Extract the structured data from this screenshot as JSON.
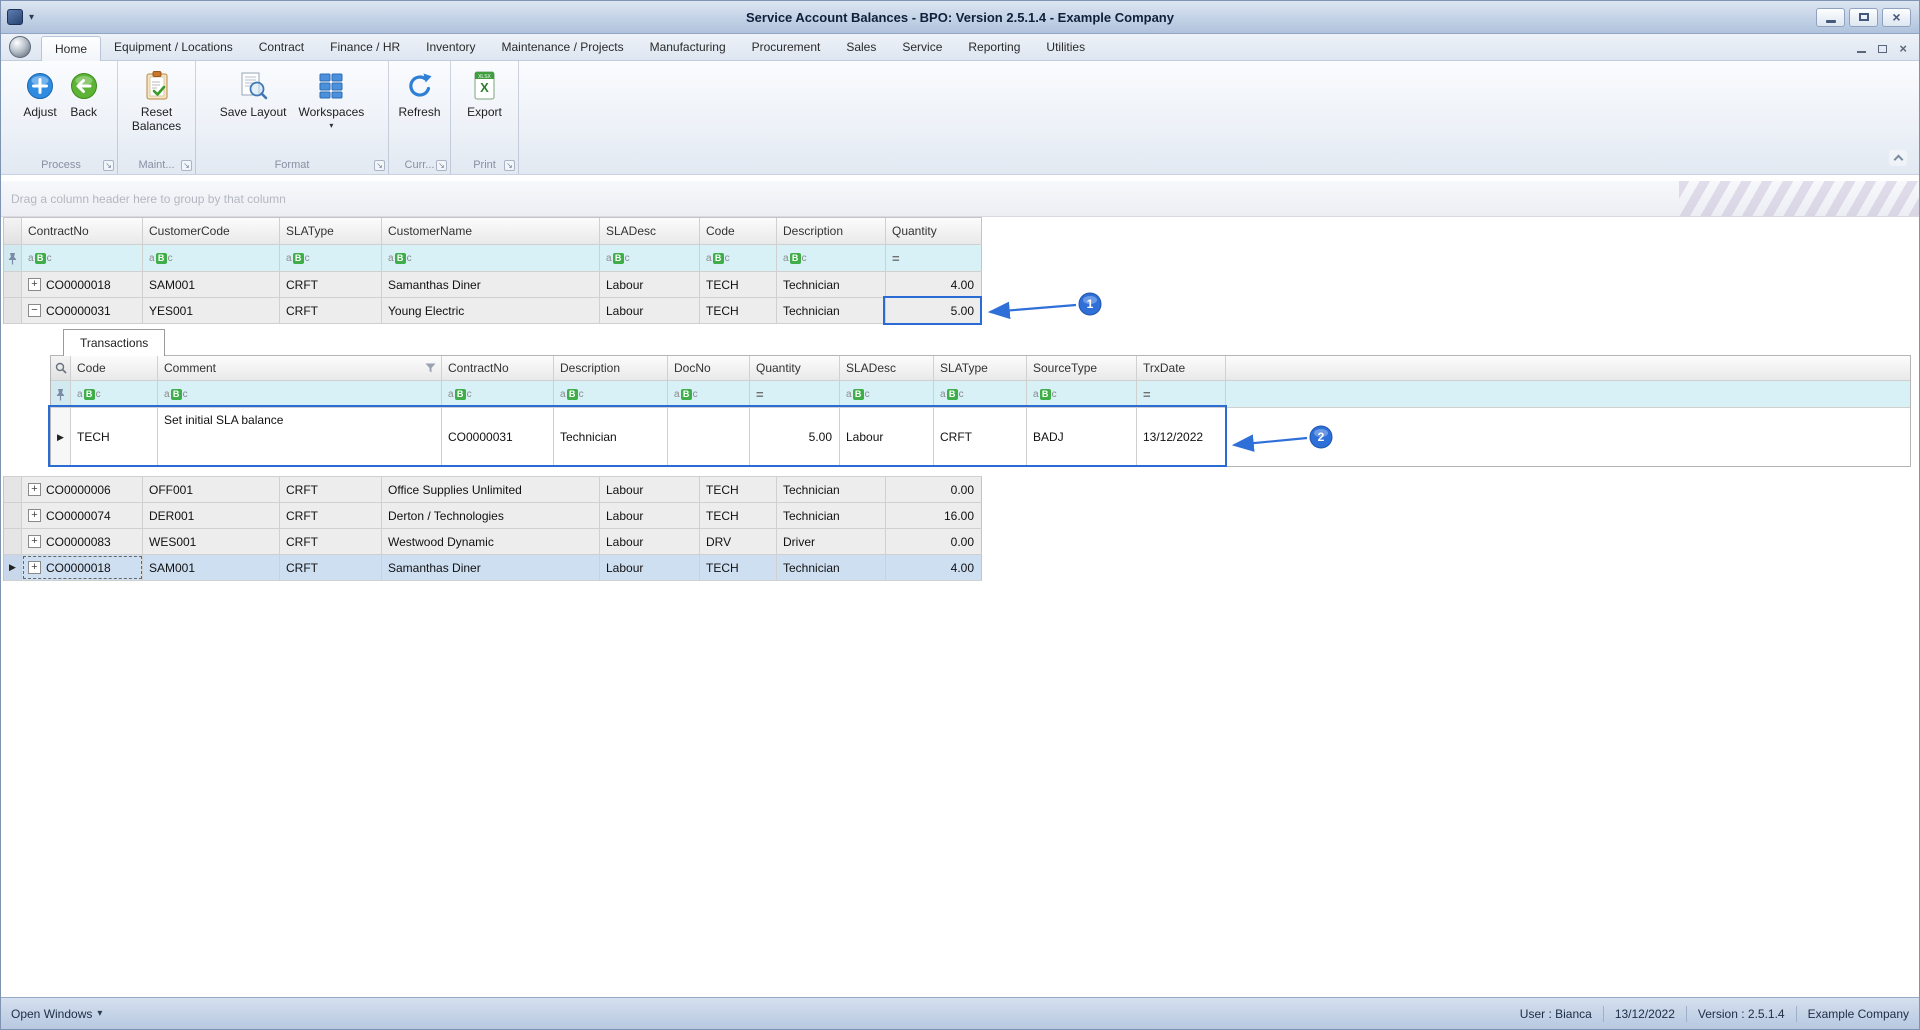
{
  "title_bar": {
    "title": "Service Account Balances - BPO: Version 2.5.1.4 - Example Company"
  },
  "ribbon": {
    "tabs": [
      "Home",
      "Equipment / Locations",
      "Contract",
      "Finance / HR",
      "Inventory",
      "Maintenance / Projects",
      "Manufacturing",
      "Procurement",
      "Sales",
      "Service",
      "Reporting",
      "Utilities"
    ],
    "buttons": {
      "adjust": "Adjust",
      "back": "Back",
      "reset_balances": "Reset Balances",
      "save_layout": "Save Layout",
      "workspaces": "Workspaces",
      "refresh": "Refresh",
      "export": "Export"
    },
    "groups": {
      "process": "Process",
      "maint": "Maint...",
      "format": "Format",
      "curr": "Curr...",
      "print": "Print"
    }
  },
  "grid": {
    "group_hint": "Drag a column header here to group by that column",
    "headers": [
      "ContractNo",
      "CustomerCode",
      "SLAType",
      "CustomerName",
      "SLADesc",
      "Code",
      "Description",
      "Quantity"
    ],
    "rows": [
      {
        "contract": "CO0000018",
        "customer_code": "SAM001",
        "sla_type": "CRFT",
        "customer_name": "Samanthas Diner",
        "sla_desc": "Labour",
        "code": "TECH",
        "description": "Technician",
        "quantity": "4.00"
      },
      {
        "contract": "CO0000031",
        "customer_code": "YES001",
        "sla_type": "CRFT",
        "customer_name": "Young Electric",
        "sla_desc": "Labour",
        "code": "TECH",
        "description": "Technician",
        "quantity": "5.00"
      },
      {
        "contract": "CO0000006",
        "customer_code": "OFF001",
        "sla_type": "CRFT",
        "customer_name": "Office Supplies Unlimited",
        "sla_desc": "Labour",
        "code": "TECH",
        "description": "Technician",
        "quantity": "0.00"
      },
      {
        "contract": "CO0000074",
        "customer_code": "DER001",
        "sla_type": "CRFT",
        "customer_name": "Derton / Technologies",
        "sla_desc": "Labour",
        "code": "TECH",
        "description": "Technician",
        "quantity": "16.00"
      },
      {
        "contract": "CO0000083",
        "customer_code": "WES001",
        "sla_type": "CRFT",
        "customer_name": "Westwood Dynamic",
        "sla_desc": "Labour",
        "code": "DRV",
        "description": "Driver",
        "quantity": "0.00"
      },
      {
        "contract": "CO0000018",
        "customer_code": "SAM001",
        "sla_type": "CRFT",
        "customer_name": "Samanthas Diner",
        "sla_desc": "Labour",
        "code": "TECH",
        "description": "Technician",
        "quantity": "4.00"
      }
    ]
  },
  "detail": {
    "tab_label": "Transactions",
    "headers": [
      "Code",
      "Comment",
      "ContractNo",
      "Description",
      "DocNo",
      "Quantity",
      "SLADesc",
      "SLAType",
      "SourceType",
      "TrxDate"
    ],
    "rows": [
      {
        "code": "TECH",
        "comment": "Set initial SLA balance",
        "contract": "CO0000031",
        "description": "Technician",
        "doc_no": "",
        "quantity": "5.00",
        "sla_desc": "Labour",
        "sla_type": "CRFT",
        "source_type": "BADJ",
        "trx_date": "13/12/2022"
      }
    ]
  },
  "annotations": [
    {
      "number": "1"
    },
    {
      "number": "2"
    }
  ],
  "status_bar": {
    "open_windows": "Open Windows",
    "user": "User : Bianca",
    "date": "13/12/2022",
    "version": "Version : 2.5.1.4",
    "company": "Example Company"
  },
  "icons": {
    "caret_down": "▾",
    "close": "×",
    "abc_a": "a",
    "abc_b": "B",
    "abc_c": "c",
    "equals": "=",
    "plus": "+",
    "minus": "−",
    "row_arrow": "▶",
    "launcher": "↘",
    "export_x": "X",
    "xlsx_label": "XLSX"
  },
  "colors": {
    "annotation_blue": "#2e6fd8",
    "filter_row_bg": "#d8f1f7",
    "selected_row_bg": "#cfdff2",
    "titlebar_gradient_top": "#dde6f2"
  }
}
